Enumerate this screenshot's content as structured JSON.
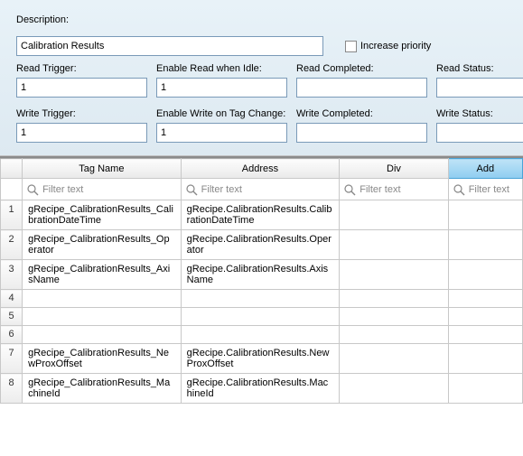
{
  "form": {
    "description_label": "Description:",
    "description_value": "Calibration Results",
    "increase_priority_label": "Increase priority",
    "increase_priority_checked": false,
    "read_trigger_label": "Read Trigger:",
    "read_trigger_value": "1",
    "enable_read_idle_label": "Enable Read when Idle:",
    "enable_read_idle_value": "1",
    "read_completed_label": "Read Completed:",
    "read_completed_value": "",
    "read_status_label": "Read Status:",
    "read_status_value": "",
    "write_trigger_label": "Write Trigger:",
    "write_trigger_value": "1",
    "enable_write_tag_label": "Enable Write on Tag Change:",
    "enable_write_tag_value": "1",
    "write_completed_label": "Write Completed:",
    "write_completed_value": "",
    "write_status_label": "Write Status:",
    "write_status_value": ""
  },
  "table": {
    "headers": {
      "tag_name": "Tag Name",
      "address": "Address",
      "div": "Div",
      "add": "Add"
    },
    "filter_placeholder": "Filter text",
    "rows": [
      {
        "num": "1",
        "tag": "gRecipe_CalibrationResults_CalibrationDateTime",
        "addr": "gRecipe.CalibrationResults.CalibrationDateTime",
        "div": "",
        "add": ""
      },
      {
        "num": "2",
        "tag": "gRecipe_CalibrationResults_Operator",
        "addr": "gRecipe.CalibrationResults.Operator",
        "div": "",
        "add": ""
      },
      {
        "num": "3",
        "tag": "gRecipe_CalibrationResults_AxisName",
        "addr": "gRecipe.CalibrationResults.AxisName",
        "div": "",
        "add": ""
      },
      {
        "num": "4",
        "tag": "",
        "addr": "",
        "div": "",
        "add": ""
      },
      {
        "num": "5",
        "tag": "",
        "addr": "",
        "div": "",
        "add": ""
      },
      {
        "num": "6",
        "tag": "",
        "addr": "",
        "div": "",
        "add": ""
      },
      {
        "num": "7",
        "tag": "gRecipe_CalibrationResults_NewProxOffset",
        "addr": "gRecipe.CalibrationResults.NewProxOffset",
        "div": "",
        "add": ""
      },
      {
        "num": "8",
        "tag": "gRecipe_CalibrationResults_MachineId",
        "addr": "gRecipe.CalibrationResults.MachineId",
        "div": "",
        "add": ""
      }
    ]
  }
}
